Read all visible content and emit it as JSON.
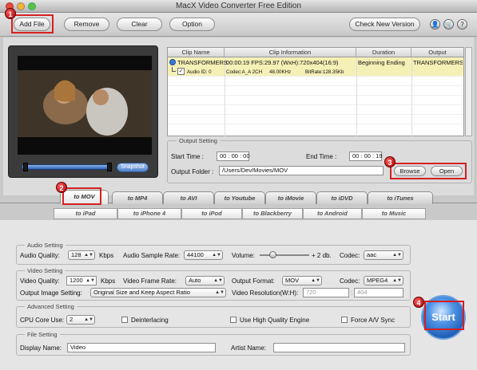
{
  "window": {
    "title": "MacX Video Converter Free Edition"
  },
  "toolbar": {
    "add_file": "Add File",
    "remove": "Remove",
    "clear": "Clear",
    "option": "Option",
    "check_new_version": "Check New Version",
    "icon1": "👤",
    "icon2": "🛒",
    "help": "?"
  },
  "badges": {
    "b1": "1",
    "b2": "2",
    "b3": "3",
    "b4": "4"
  },
  "preview": {
    "snapshot": "Snapshot"
  },
  "table": {
    "headers": {
      "clip_name": "Clip Name",
      "clip_info": "Clip Information",
      "duration": "Duration",
      "output": "Output"
    },
    "row": {
      "name": "TRANSFORMERS",
      "info": "00:00:19  FPS:29.97  (WxH):720x404(16:9)",
      "duration": "Beginning Ending",
      "output": "TRANSFORMERS2_"
    },
    "subrow": {
      "audio": "Audio ID: 0",
      "codec": "Codec:A_A 2CH",
      "rate": "48.00KHz",
      "bitrate": "BitRate:128.35Kb"
    }
  },
  "output_setting": {
    "legend": "Output Setting",
    "start_label": "Start Time :",
    "start_value": "00 : 00 : 00",
    "end_label": "End Time :",
    "end_value": "00 : 00 : 19",
    "folder_label": "Output Folder :",
    "folder_value": "/Users/Dev/Movies/MOV",
    "browse": "Browse",
    "open": "Open"
  },
  "tabs_row1": [
    "to MOV",
    "to MP4",
    "to AVI",
    "to Youtube",
    "to iMovie",
    "to iDVD",
    "to iTunes"
  ],
  "tabs_row2": [
    "to iPad",
    "to iPhone 4",
    "to iPod",
    "to Blackberry",
    "to Android",
    "to Music"
  ],
  "audio": {
    "legend": "Audio Setting",
    "quality_label": "Audio Quality:",
    "quality": "128",
    "kbps": "Kbps",
    "rate_label": "Audio Sample Rate:",
    "rate": "44100",
    "volume_label": "Volume:",
    "volume_value": "+ 2 db.",
    "codec_label": "Codec:",
    "codec": "aac"
  },
  "video": {
    "legend": "Video Setting",
    "quality_label": "Video Quality:",
    "quality": "1200",
    "kbps": "Kbps",
    "frame_label": "Video Frame Rate:",
    "frame": "Auto",
    "format_label": "Output Format:",
    "format": "MOV",
    "codec_label": "Codec:",
    "codec": "MPEG4",
    "image_label": "Output Image Setting:",
    "image": "Original Size and Keep Aspect Ratio",
    "res_label": "Video Resolution(W:H):",
    "res_w": "720",
    "res_h": "404"
  },
  "advanced": {
    "legend": "Advanced Setting",
    "cpu_label": "CPU Core Use:",
    "cpu": "2",
    "deinterlacing": "Deinterlacing",
    "hq": "Use High Quality Engine",
    "force": "Force A/V Sync"
  },
  "file": {
    "legend": "File Setting",
    "display_label": "Display Name:",
    "display_value": "Video",
    "artist_label": "Artist Name:",
    "artist_value": ""
  },
  "start_button": "Start"
}
